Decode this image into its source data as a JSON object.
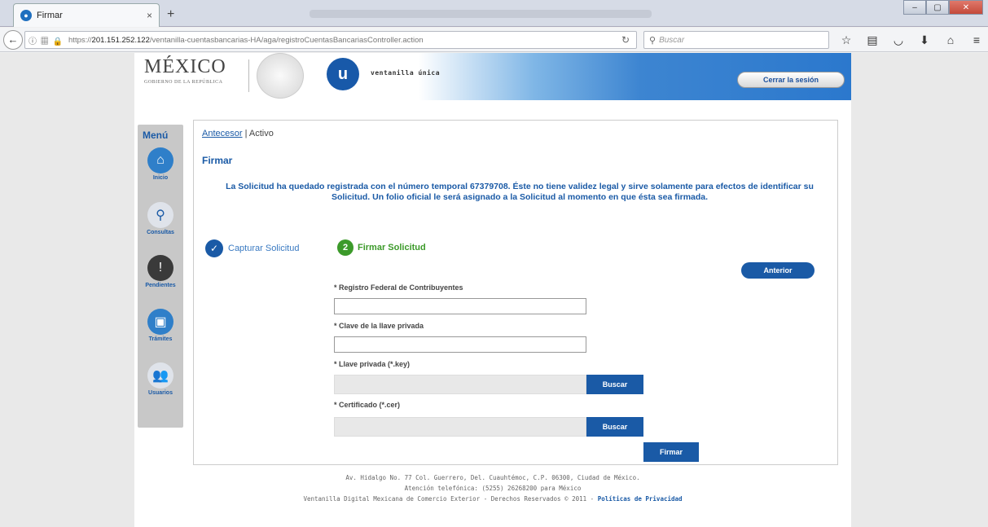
{
  "browser": {
    "tab_title": "Firmar",
    "tab_close": "×",
    "new_tab": "+",
    "url_prefix": "https://",
    "url_host": "201.151.252.122",
    "url_path": "/ventanilla-cuentasbancarias-HA/aga/registroCuentasBancariasController.action",
    "search_placeholder": "Buscar"
  },
  "header": {
    "logo_word": "MÉXICO",
    "logo_sub": "GOBIERNO DE LA REPÚBLICA",
    "u_letter": "u",
    "brand_text": "ventanilla única",
    "logout_label": "Cerrar la sesión"
  },
  "sidebar": {
    "title": "Menú",
    "items": [
      {
        "label": "Inicio",
        "color": "#2f7fc9"
      },
      {
        "label": "Consultas",
        "color": "#dfe3ea"
      },
      {
        "label": "Pendientes",
        "color": "#3a3a3a"
      },
      {
        "label": "Trámites",
        "color": "#2f7fc9"
      },
      {
        "label": "Usuarios",
        "color": "#dfe3ea"
      }
    ]
  },
  "breadcrumb": {
    "link": "Antecesor",
    "separator": " | ",
    "current": "Activo"
  },
  "section_title": "Firmar",
  "info_message": "La Solicitud ha quedado registrada con el número temporal 67379708. Éste no tiene validez legal y sirve solamente para efectos de identificar su Solicitud. Un folio oficial le será asignado a la Solicitud al momento en que ésta sea firmada.",
  "steps": {
    "step1_label": "Capturar Solicitud",
    "step2_number": "2",
    "step2_label": "Firmar Solicitud"
  },
  "form": {
    "prev_label": "Anterior",
    "rfc_label": "* Registro Federal de Contribuyentes",
    "rfc_value": "",
    "pass_label": "* Clave de la llave privada",
    "pass_value": "",
    "key_label": "* Llave privada (*.key)",
    "cert_label": "* Certificado (*.cer)",
    "browse_label": "Buscar",
    "sign_label": "Firmar"
  },
  "footer": {
    "line1": "Av. Hidalgo No. 77 Col. Guerrero, Del. Cuauhtémoc, C.P. 06300, Ciudad de México.",
    "line2": "Atención telefónica: (5255) 26268200 para México",
    "line3": "Ventanilla Digital Mexicana de Comercio Exterior - Derechos Reservados © 2011 - ",
    "privacy_link": "Políticas de Privacidad"
  }
}
